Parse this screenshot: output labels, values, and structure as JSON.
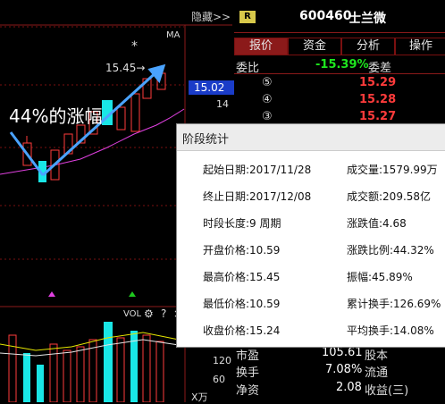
{
  "header": {
    "hide_label": "隐藏>>",
    "stock_badge": "R",
    "stock_code": "600460",
    "stock_name": "士兰微",
    "ma_label": "MA",
    "price_marker": "15.02",
    "axis_14": "14",
    "high_marker": "15.45",
    "star": "*",
    "annotation": "44%的涨幅",
    "vol_label": "VOL"
  },
  "tabs": [
    "报价",
    "资金",
    "分析",
    "操作"
  ],
  "quote": {
    "ratio_label": "委比",
    "ratio_value": "-15.39%",
    "diff_label": "委差"
  },
  "order_book": [
    {
      "level": "⑤",
      "price": "15.29"
    },
    {
      "level": "④",
      "price": "15.28"
    },
    {
      "level": "③",
      "price": "15.27"
    }
  ],
  "popup": {
    "title": "阶段统计",
    "left": [
      "起始日期:2017/11/28",
      "终止日期:2017/12/08",
      "时段长度:9 周期",
      "开盘价格:10.59",
      "最高价格:15.45",
      "最低价格:10.59",
      "收盘价格:15.24"
    ],
    "right": [
      "成交量:1579.99万",
      "成交额:209.58亿",
      "涨跌值:4.68",
      "涨跌比例:44.32%",
      "振幅:45.89%",
      "累计换手:126.69%",
      "平均换手:14.08%"
    ]
  },
  "volume_axis": [
    "120",
    "60",
    "X万"
  ],
  "bottom": [
    {
      "label": "市盈",
      "value": "105.61",
      "label2": "股本"
    },
    {
      "label": "换手",
      "value": "7.08%",
      "label2": "流通"
    },
    {
      "label": "净资",
      "value": "2.08",
      "label2": "收益(三)"
    }
  ],
  "colors": {
    "up": "#ff3b3b",
    "down": "#19e6e6",
    "accent": "#4aa3ff",
    "ma": "#e040e0"
  }
}
